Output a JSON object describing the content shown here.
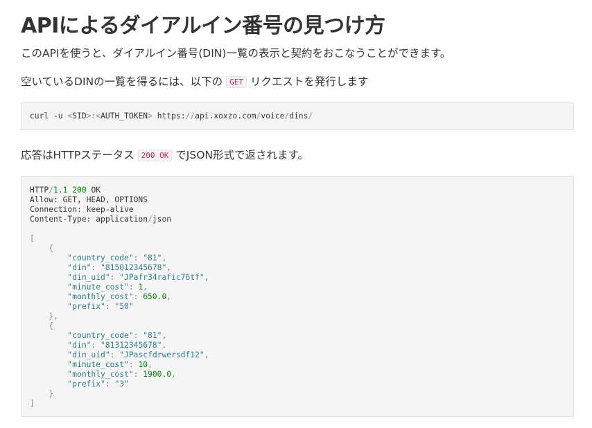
{
  "page": {
    "title": "APIによるダイアルイン番号の見つけ方",
    "intro": "このAPIを使うと、ダイアルイン番号(DIN)一覧の表示と契約をおこなうことができます。",
    "list_lead_before": "空いているDINの一覧を得るには、以下の",
    "list_lead_code": "GET",
    "list_lead_after": "リクエストを発行します",
    "response_lead_before": "応答はHTTPステータス",
    "response_lead_code": "200 OK",
    "response_lead_after": "でJSON形式で返されます。"
  },
  "request_block": {
    "cmd": "curl -u ",
    "lt1": "<",
    "sid": "SID",
    "gt1": ">",
    "colon": ":",
    "lt2": "<",
    "token": "AUTH_TOKEN",
    "gt2": ">",
    "url_a": " https:",
    "url_s1": "//",
    "url_b": "api.xoxzo.com",
    "url_s2": "/",
    "url_c": "voice",
    "url_s3": "/",
    "url_d": "dins",
    "url_s4": "/"
  },
  "response_block": {
    "status_proto": "HTTP",
    "status_slash": "/",
    "status_version": "1.1",
    "status_code": "200",
    "status_text": "OK",
    "headers": [
      "Allow: GET, HEAD, OPTIONS",
      "Connection: keep-alive"
    ],
    "content_type_key": "Content-Type: application",
    "content_type_slash": "/",
    "content_type_val": "json",
    "items": [
      {
        "country_code": "\"81\"",
        "din": "\"815012345678\"",
        "din_uid": "\"JPafr34rafic76tf\"",
        "minute_cost": "1",
        "monthly_cost": "650.0",
        "prefix": "\"50\""
      },
      {
        "country_code": "\"81\"",
        "din": "\"81312345678\"",
        "din_uid": "\"JPascfdrwersdf12\"",
        "minute_cost": "10",
        "monthly_cost": "1900.0",
        "prefix": "\"3\""
      }
    ],
    "keys": {
      "country_code": "\"country_code\"",
      "din": "\"din\"",
      "din_uid": "\"din_uid\"",
      "minute_cost": "\"minute_cost\"",
      "monthly_cost": "\"monthly_cost\"",
      "prefix": "\"prefix\""
    }
  }
}
